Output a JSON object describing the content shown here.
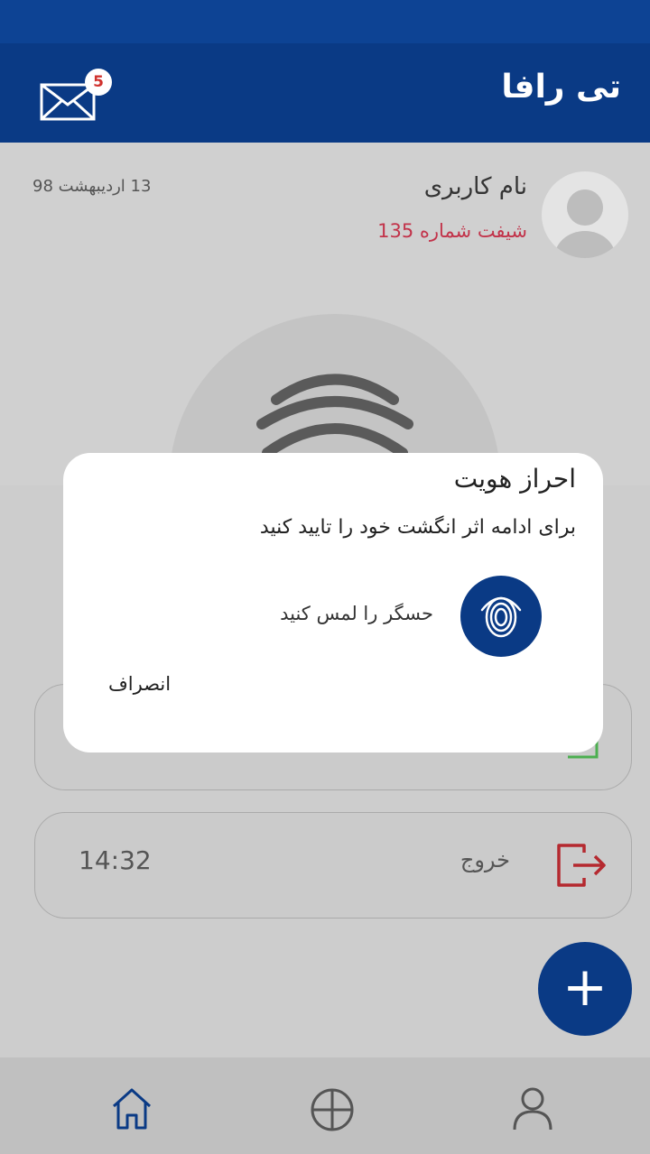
{
  "header": {
    "app_title": "تی رافا",
    "mail_icon": "mail-icon",
    "unread_count": "5"
  },
  "user": {
    "name": "نام کاربری",
    "shift": "شیفت شماره 135",
    "date": "13 اردیبهشت 98",
    "avatar_icon": "avatar-icon"
  },
  "checkout": {
    "label": "خروج",
    "time": "14:32",
    "icon": "exit-icon"
  },
  "fab": {
    "label": "+"
  },
  "bottom_nav": {
    "items": [
      {
        "icon": "home-icon"
      },
      {
        "icon": "pie-chart-icon"
      },
      {
        "icon": "profile-icon"
      }
    ]
  },
  "dialog": {
    "title": "احراز هویت",
    "message": "برای ادامه اثر انگشت خود را تایید کنید",
    "sensor_label": "حسگر را لمس کنید",
    "cancel_label": "انصراف"
  },
  "colors": {
    "primary": "#0a3a85",
    "status_bar": "#0d4394",
    "accent_red": "#c2334a",
    "checkout_red": "#b5292f",
    "checkin_green": "#4caf50"
  }
}
